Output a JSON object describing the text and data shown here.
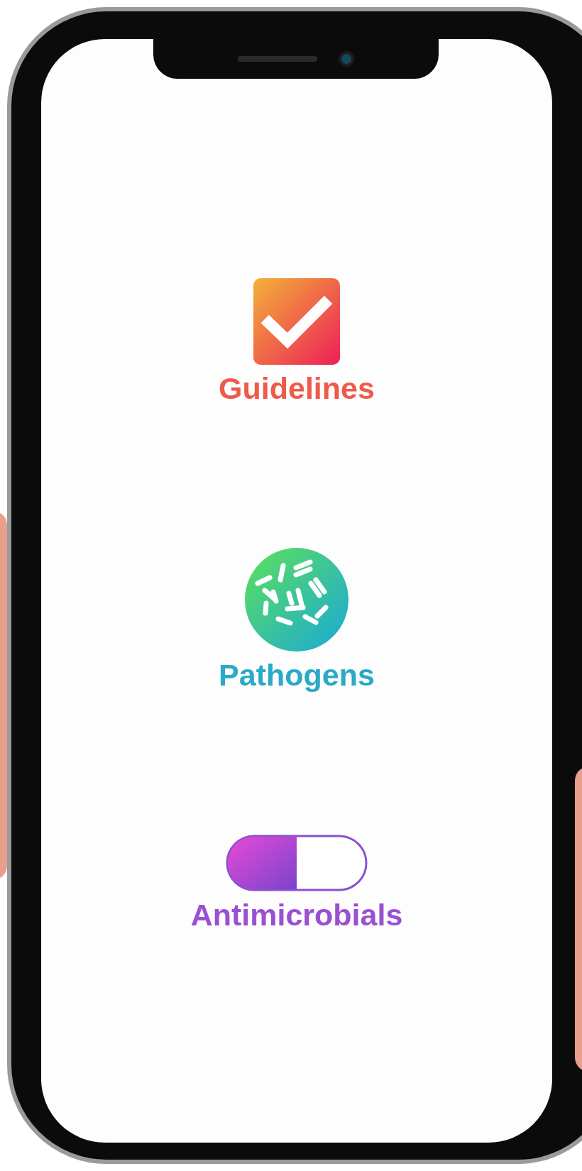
{
  "menu": [
    {
      "kind": "checklist",
      "label": "Guidelines",
      "color": "#ee5a4b"
    },
    {
      "kind": "bacteria",
      "label": "Pathogens",
      "color": "#2aaac6"
    },
    {
      "kind": "capsule",
      "label": "Antimicrobials",
      "color": "#9a50d2"
    }
  ]
}
